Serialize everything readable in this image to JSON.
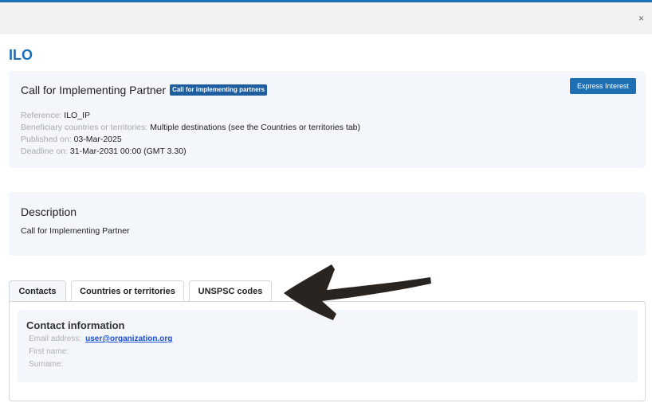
{
  "window": {
    "close_glyph": "×"
  },
  "org": "ILO",
  "call": {
    "title": "Call for Implementing Partner",
    "badge": "Call for implementing partners",
    "express_button": "Express Interest",
    "meta": [
      {
        "label": "Reference:",
        "value": "ILO_IP"
      },
      {
        "label": "Beneficiary countries or territories:",
        "value": "Multiple destinations (see the Countries or territories tab)"
      },
      {
        "label": "Published on:",
        "value": "03-Mar-2025"
      },
      {
        "label": "Deadline on:",
        "value": "31-Mar-2031 00:00 (GMT 3.30)"
      }
    ]
  },
  "description": {
    "title": "Description",
    "text": "Call for Implementing Partner"
  },
  "tabs": [
    {
      "label": "Contacts",
      "active": true
    },
    {
      "label": "Countries or territories",
      "active": false
    },
    {
      "label": "UNSPSC codes",
      "active": false
    }
  ],
  "contact": {
    "title": "Contact information",
    "email_label": "Email address:",
    "email_value": "user@organization.org",
    "first_name_label": "First name:",
    "surname_label": "Surname:"
  },
  "colors": {
    "accent": "#1f6fb5",
    "card_bg": "#f3f6fa",
    "arrow": "#2a2420"
  },
  "annotation_icon": "arrow-left-icon"
}
